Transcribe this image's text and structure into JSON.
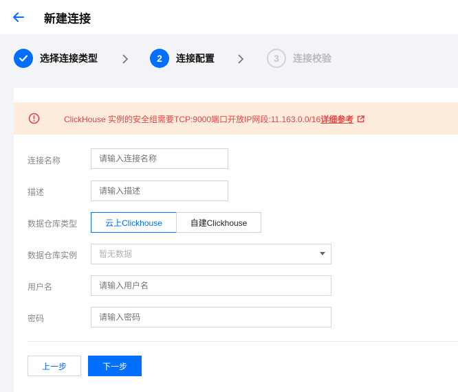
{
  "header": {
    "title": "新建连接"
  },
  "steps": [
    {
      "label": "选择连接类型",
      "state": "done"
    },
    {
      "number": "2",
      "label": "连接配置",
      "state": "active"
    },
    {
      "number": "3",
      "label": "连接校验",
      "state": "pending"
    }
  ],
  "alert": {
    "text": "ClickHouse 实例的安全组需要TCP:9000端口开放IP网段:11.163.0.0/16",
    "link": "详细参考"
  },
  "form": {
    "name": {
      "label": "连接名称",
      "placeholder": "请输入连接名称"
    },
    "description": {
      "label": "描述",
      "placeholder": "请输入描述"
    },
    "warehouse_type": {
      "label": "数据仓库类型",
      "options": [
        "云上Clickhouse",
        "自建Clickhouse"
      ],
      "selected": "云上Clickhouse"
    },
    "instance": {
      "label": "数据仓库实例",
      "value": "暂无数据"
    },
    "username": {
      "label": "用户名",
      "placeholder": "请输入用户名"
    },
    "password": {
      "label": "密码",
      "placeholder": "请输入密码"
    }
  },
  "buttons": {
    "prev": "上一步",
    "next": "下一步"
  },
  "colors": {
    "accent": "#006eff",
    "alert_bg": "#fdebdc",
    "alert_text": "#e54545"
  }
}
